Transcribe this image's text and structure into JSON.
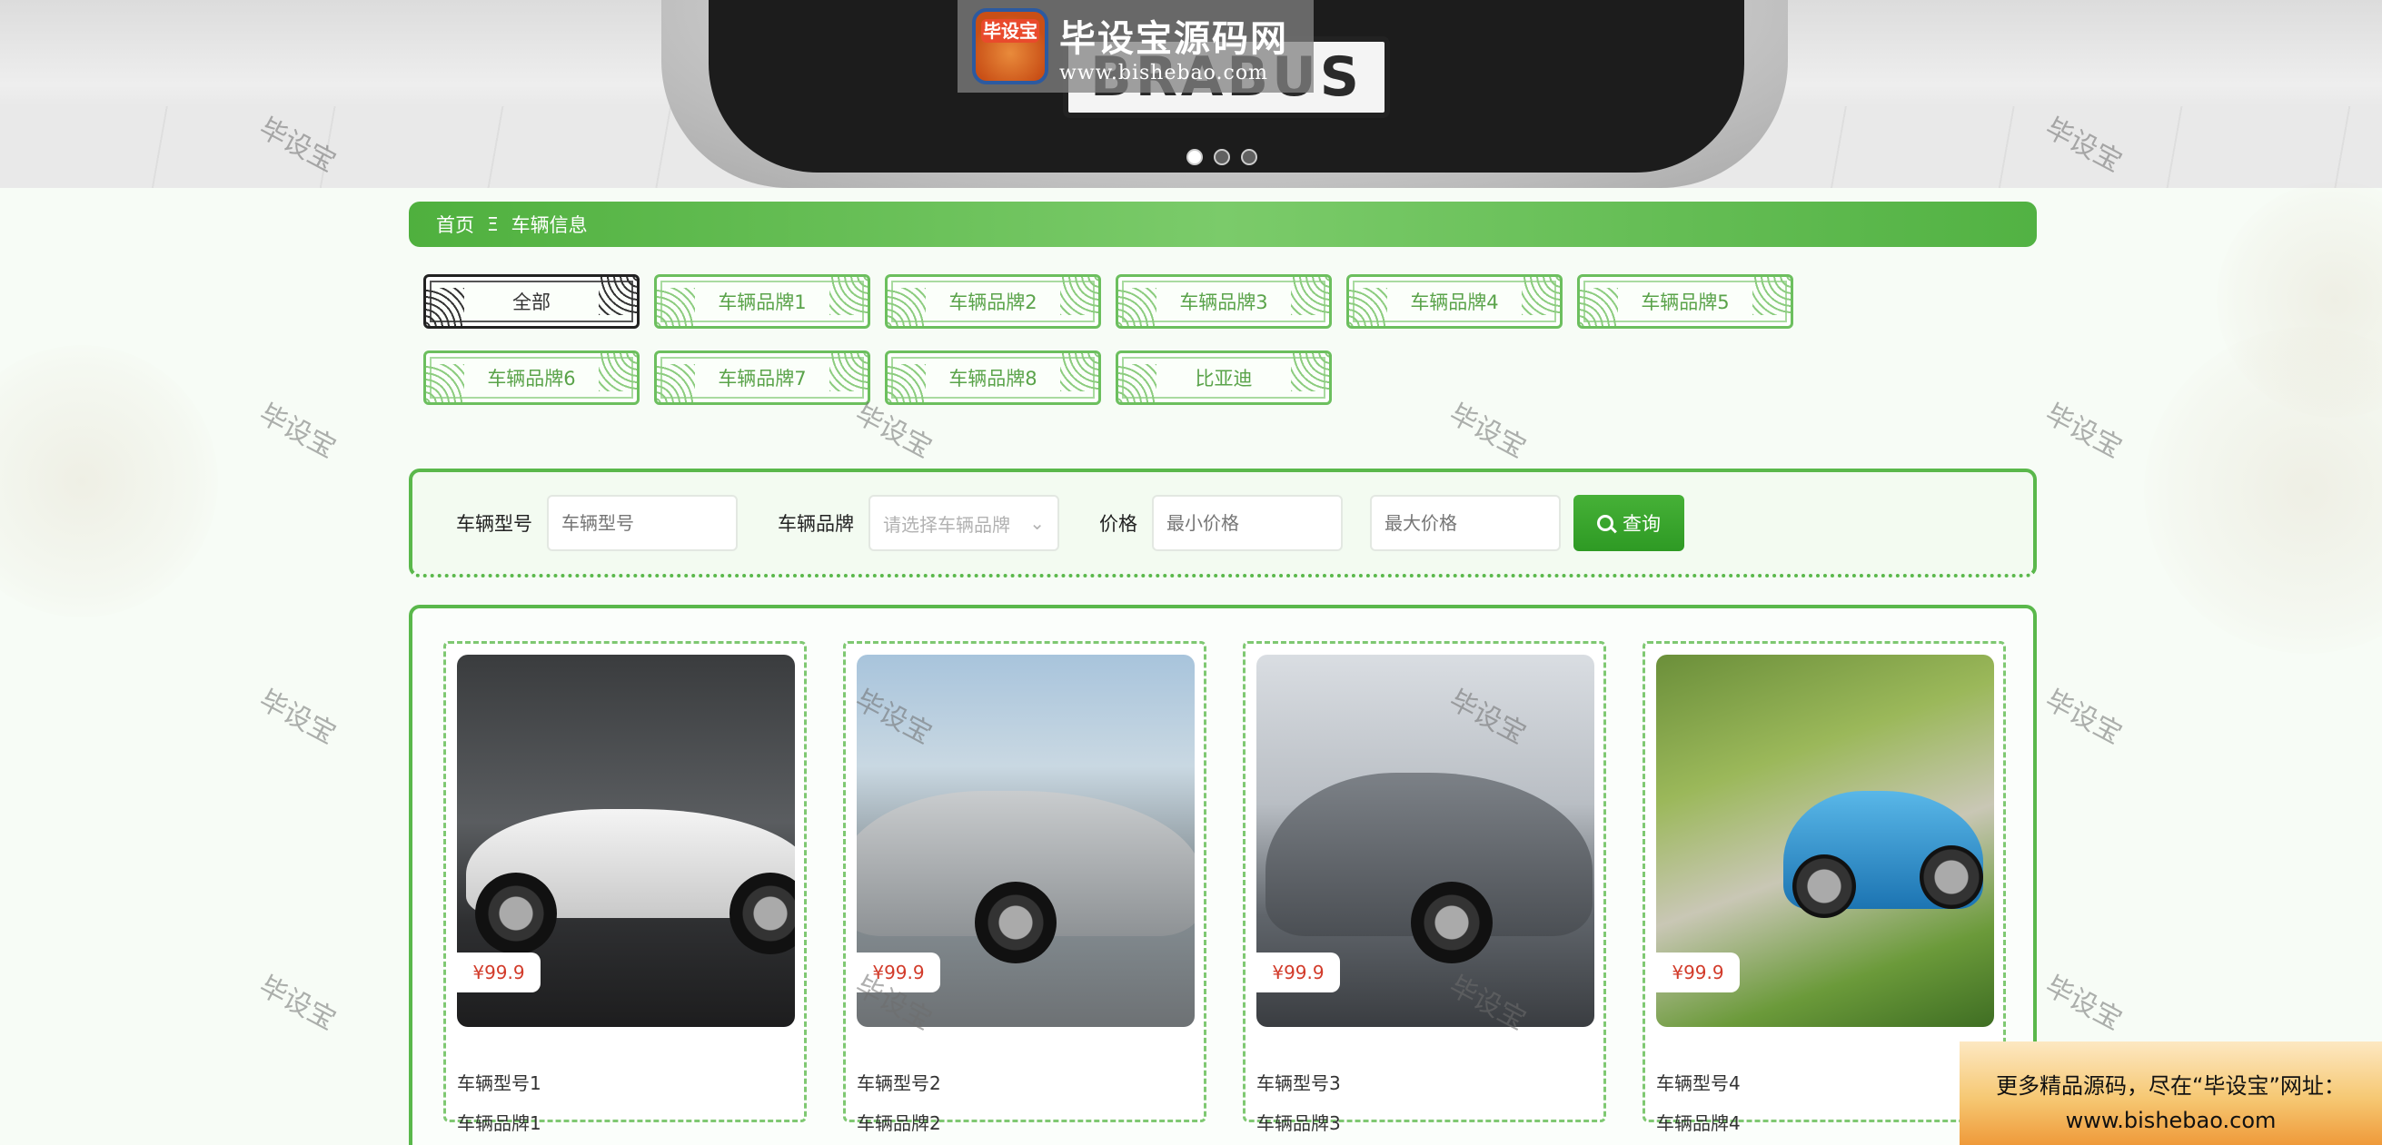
{
  "banner": {
    "logo_cn": "毕设宝源码网",
    "logo_url": "www.bishebao.com",
    "seal_text": "毕设宝",
    "plate_text": "BRABUS",
    "dots": 3,
    "active_dot": 0
  },
  "watermark": "毕设宝",
  "breadcrumb": {
    "home": "首页",
    "separator": "Ξ",
    "current": "车辆信息"
  },
  "brands": [
    "全部",
    "车辆品牌1",
    "车辆品牌2",
    "车辆品牌3",
    "车辆品牌4",
    "车辆品牌5",
    "车辆品牌6",
    "车辆品牌7",
    "车辆品牌8",
    "比亚迪"
  ],
  "active_brand": 0,
  "search": {
    "model_label": "车辆型号",
    "model_placeholder": "车辆型号",
    "brand_label": "车辆品牌",
    "brand_placeholder": "请选择车辆品牌",
    "price_label": "价格",
    "min_placeholder": "最小价格",
    "max_placeholder": "最大价格",
    "button_label": "查询"
  },
  "cars": [
    {
      "price": "¥99.9",
      "model": "车辆型号1",
      "brand": "车辆品牌1"
    },
    {
      "price": "¥99.9",
      "model": "车辆型号2",
      "brand": "车辆品牌2"
    },
    {
      "price": "¥99.9",
      "model": "车辆型号3",
      "brand": "车辆品牌3"
    },
    {
      "price": "¥99.9",
      "model": "车辆型号4",
      "brand": "车辆品牌4"
    }
  ],
  "promo": {
    "line1": "更多精品源码，尽在“毕设宝”网址：",
    "line2": "www.bishebao.com"
  },
  "colors": {
    "accent": "#4fb03e",
    "price": "#d23b2a"
  }
}
